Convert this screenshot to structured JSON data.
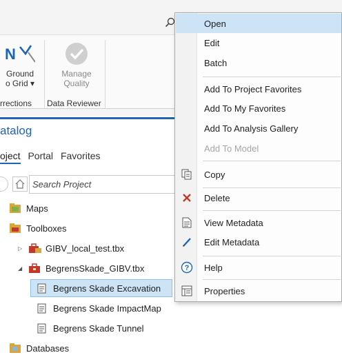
{
  "ribbon": {
    "ground_to_grid": {
      "label_line1": "Ground",
      "label_line2": "o Grid ▾"
    },
    "manage_quality": {
      "label_line1": "Manage",
      "label_line2": "Quality"
    },
    "group_corrections": "rrections",
    "group_data_reviewer": "Data Reviewer"
  },
  "catalog": {
    "title": "atalog",
    "tabs": [
      "oject",
      "Portal",
      "Favorites"
    ],
    "search_placeholder": "Search Project",
    "tree": [
      {
        "label": "Maps",
        "icon": "map-folder-icon"
      },
      {
        "label": "Toolboxes",
        "icon": "toolboxes-icon"
      },
      {
        "label": "GIBV_local_test.tbx",
        "icon": "toolbox-icon",
        "expander": "▷"
      },
      {
        "label": "BegrensSkade_GIBV.tbx",
        "icon": "toolbox-icon",
        "expander": "◢"
      },
      {
        "label": "Begrens Skade Excavation",
        "icon": "script-tool-icon",
        "selected": true
      },
      {
        "label": "Begrens Skade ImpactMap",
        "icon": "script-tool-icon"
      },
      {
        "label": "Begrens Skade Tunnel",
        "icon": "script-tool-icon"
      },
      {
        "label": "Databases",
        "icon": "databases-icon"
      }
    ]
  },
  "context_menu": {
    "items": [
      {
        "label": "Open",
        "icon": "",
        "state": "hover"
      },
      {
        "label": "Edit",
        "icon": ""
      },
      {
        "label": "Batch",
        "icon": ""
      },
      {
        "label": "Add To Project Favorites",
        "icon": ""
      },
      {
        "label": "Add To My Favorites",
        "icon": ""
      },
      {
        "label": "Add To Analysis Gallery",
        "icon": ""
      },
      {
        "label": "Add To Model",
        "icon": "",
        "state": "disabled"
      },
      {
        "label": "Copy",
        "icon": "copy-icon"
      },
      {
        "label": "Delete",
        "icon": "delete-icon"
      },
      {
        "label": "View Metadata",
        "icon": "view-metadata-icon"
      },
      {
        "label": "Edit Metadata",
        "icon": "edit-metadata-icon"
      },
      {
        "label": "Help",
        "icon": "help-icon"
      },
      {
        "label": "Properties",
        "icon": "properties-icon"
      }
    ]
  },
  "colors": {
    "accent": "#1c64b4",
    "selection": "#cde4f7",
    "delete_red": "#c0392b"
  }
}
